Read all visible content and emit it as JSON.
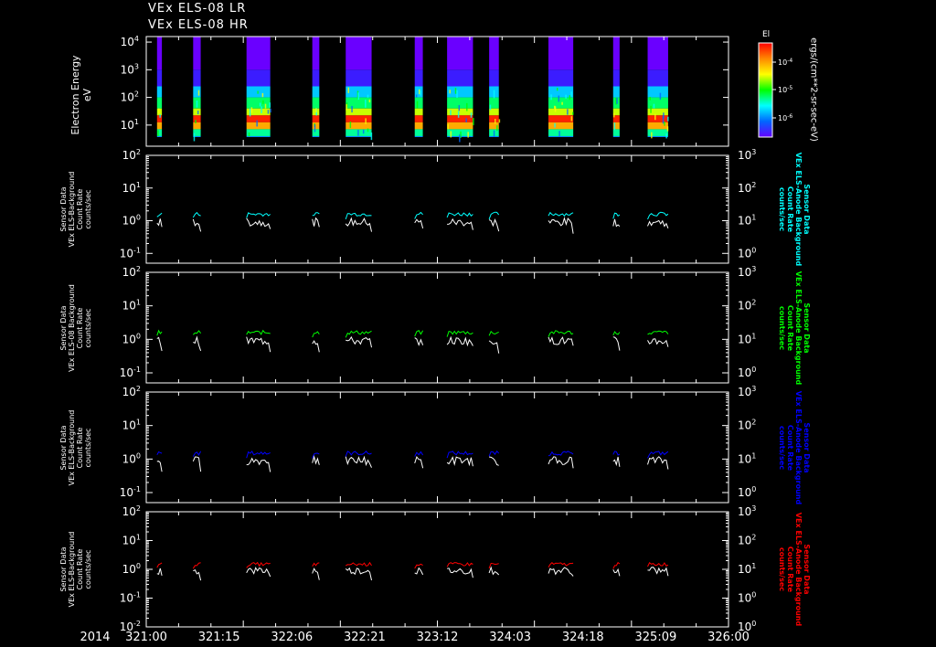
{
  "titles": [
    "VEx ELS-08 LR",
    "VEx ELS-08 HR"
  ],
  "spectrogram": {
    "ylabel_lines": [
      "Electron Energy",
      "eV"
    ],
    "ytick_labels": [
      "10",
      "10",
      "10",
      "10"
    ],
    "ytick_exps": [
      "1",
      "2",
      "3",
      "4"
    ],
    "colorbar": {
      "title": "El",
      "unit": "ergs/(cm**2-sr-sec-eV)",
      "tick_labels": [
        "10",
        "10",
        "10"
      ],
      "tick_exps": [
        "-4",
        "-5",
        "-6"
      ],
      "colors": [
        "#ff0000",
        "#ff8800",
        "#ffff00",
        "#00ff00",
        "#00ffff",
        "#0066ff",
        "#6600ff"
      ]
    },
    "segments": [
      [
        1.0,
        1.45
      ],
      [
        4.35,
        5.05
      ],
      [
        9.3,
        11.5
      ],
      [
        15.4,
        16.05
      ],
      [
        18.5,
        20.9
      ],
      [
        24.9,
        25.65
      ],
      [
        27.9,
        30.3
      ],
      [
        31.8,
        32.7
      ],
      [
        37.3,
        39.6
      ],
      [
        43.3,
        43.9
      ],
      [
        46.5,
        48.4
      ]
    ]
  },
  "x_axis": {
    "year_label": "2014",
    "tick_labels": [
      "321:00",
      "321:15",
      "322:06",
      "322:21",
      "323:12",
      "324:03",
      "324:18",
      "325:09",
      "326:00"
    ],
    "range_hours": [
      0,
      54
    ]
  },
  "panels": [
    {
      "left_label_lines": [
        "Sensor Data",
        "VEx ELS-Background",
        "Count Rate",
        "counts/sec"
      ],
      "right_label_lines": [
        "Sensor Data",
        "VEx ELS-Anode Background",
        "Count Rate",
        "counts/sec"
      ],
      "color": "#00ffff",
      "left_ticks": [
        "10",
        "10",
        "10",
        "10"
      ],
      "left_exps": [
        "2",
        "1",
        "0",
        "-1"
      ],
      "right_ticks": [
        "10",
        "10",
        "10",
        "10"
      ],
      "right_exps": [
        "3",
        "2",
        "1",
        "0"
      ]
    },
    {
      "left_label_lines": [
        "Sensor Data",
        "VEx ELS-08 Background",
        "Count Rate",
        "counts/sec"
      ],
      "right_label_lines": [
        "Sensor Data",
        "VEx ELS-Anode Background",
        "Count Rate",
        "counts/sec"
      ],
      "color": "#00ff00",
      "left_ticks": [
        "10",
        "10",
        "10",
        "10"
      ],
      "left_exps": [
        "2",
        "1",
        "0",
        "-1"
      ],
      "right_ticks": [
        "10",
        "10",
        "10",
        "10"
      ],
      "right_exps": [
        "3",
        "2",
        "1",
        "0"
      ]
    },
    {
      "left_label_lines": [
        "Sensor Data",
        "VEx ELS-Background",
        "Count Rate",
        "counts/sec"
      ],
      "right_label_lines": [
        "Sensor Data",
        "VEx ELS-Anode Background",
        "Count Rate",
        "counts/sec"
      ],
      "color": "#0000ff",
      "left_ticks": [
        "10",
        "10",
        "10",
        "10"
      ],
      "left_exps": [
        "2",
        "1",
        "0",
        "-1"
      ],
      "right_ticks": [
        "10",
        "10",
        "10",
        "10"
      ],
      "right_exps": [
        "3",
        "2",
        "1",
        "0"
      ]
    },
    {
      "left_label_lines": [
        "Sensor Data",
        "VEx ELS-Background",
        "Count Rate",
        "counts/sec"
      ],
      "right_label_lines": [
        "Sensor Data",
        "VEx ELS-Anode Background",
        "Count Rate",
        "counts/sec"
      ],
      "color": "#ff0000",
      "left_ticks": [
        "10",
        "10",
        "10",
        "10",
        "10"
      ],
      "left_exps": [
        "2",
        "1",
        "0",
        "-1",
        "-2"
      ],
      "right_ticks": [
        "10",
        "10",
        "10",
        "10",
        "10"
      ],
      "right_exps": [
        "3",
        "2",
        "1",
        "0",
        "0"
      ]
    }
  ],
  "chart_data": {
    "type": "line",
    "x_unit": "hours since 321:00",
    "ylim_left": [
      0.01,
      100
    ],
    "ylim_right": [
      1,
      1000
    ],
    "log_scale": true,
    "series": [
      {
        "values_at_segments": {
          "colored": 1.6,
          "white": 0.9
        }
      },
      {
        "values_at_segments": {
          "colored": 1.6,
          "white": 0.9
        }
      },
      {
        "values_at_segments": {
          "colored": 1.5,
          "white": 0.9
        }
      },
      {
        "values_at_segments": {
          "colored": 1.5,
          "white": 0.9
        }
      }
    ]
  }
}
